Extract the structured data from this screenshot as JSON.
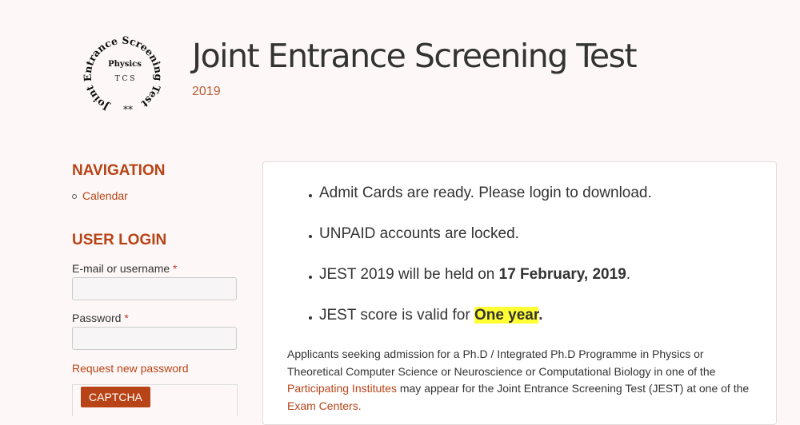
{
  "logo": {
    "ring_text": "Joint Entrance Screening Test",
    "center_top": "Physics",
    "center_bottom": "T C S",
    "stars": "**"
  },
  "header": {
    "site_name": "Joint Entrance Screening Test",
    "slogan": "2019"
  },
  "sidebar": {
    "navigation_title": "NAVIGATION",
    "nav_items": [
      {
        "label": "Calendar"
      }
    ],
    "login_title": "USER LOGIN",
    "username_label": "E-mail or username",
    "password_label": "Password",
    "required_marker": "*",
    "username_value": "",
    "password_value": "",
    "request_password_link": "Request new password",
    "captcha_label": "CAPTCHA"
  },
  "announcements": [
    {
      "text": "Admit Cards are ready.  Please login to download."
    },
    {
      "text": "UNPAID accounts are locked."
    },
    {
      "prefix": "JEST 2019 will be held on ",
      "bold": "17 February, 2019",
      "suffix": "."
    },
    {
      "prefix": "JEST score is valid for ",
      "highlight": "One year",
      "suffix": "."
    }
  ],
  "intro": {
    "part1": "Applicants seeking admission  for a Ph.D / Integrated Ph.D Programme in Physics or Theoretical Computer Science or Neuroscience or Computational Biology in  one  of the ",
    "link1": "Participating Institutes",
    "part2": " may appear for the Joint Entrance Screening Test (JEST) at one of the ",
    "link2": "Exam Centers.",
    "part3": ""
  },
  "colors": {
    "accent": "#b84316",
    "highlight": "#ffff33",
    "background": "#fdf8f7"
  }
}
